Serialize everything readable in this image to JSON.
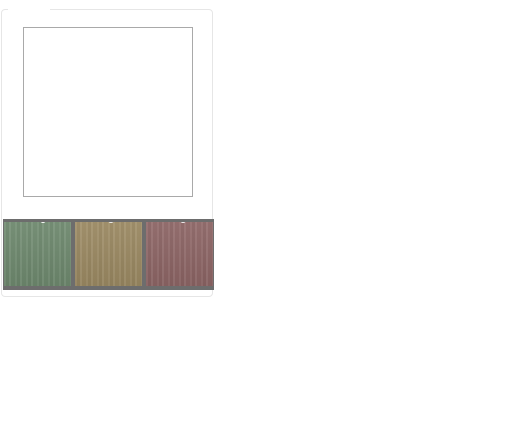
{
  "palette": {
    "swatches": [
      {
        "name": "green",
        "color": "#6f8a6f"
      },
      {
        "name": "ochre",
        "color": "#9c8a63"
      },
      {
        "name": "rose",
        "color": "#8e6666"
      }
    ]
  }
}
